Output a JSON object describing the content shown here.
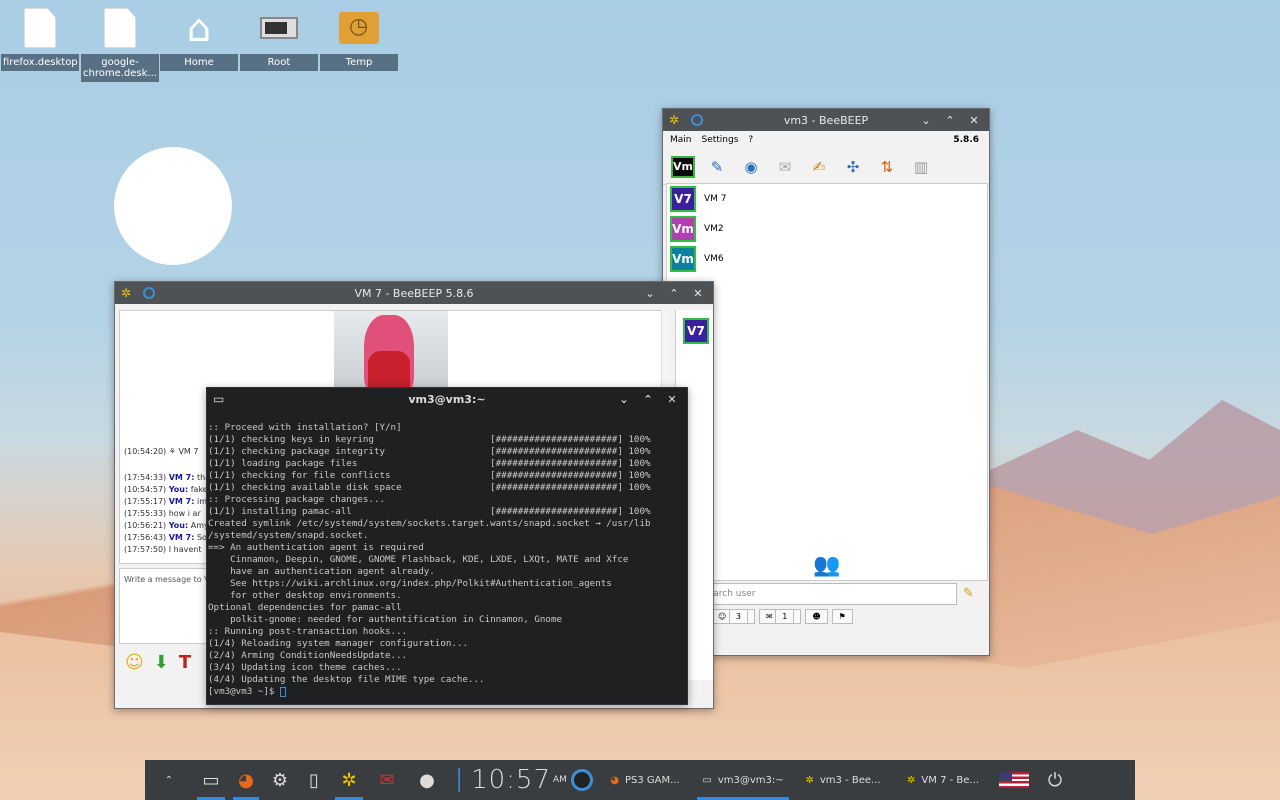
{
  "desktop": {
    "icons": [
      {
        "label": "firefox.desktop"
      },
      {
        "label": "google-chrome.desk..."
      },
      {
        "label": "Home"
      },
      {
        "label": "Root"
      },
      {
        "label": "Temp"
      }
    ]
  },
  "beebeep_main": {
    "title": "vm3 - BeeBEEP",
    "menu": {
      "main": "Main",
      "settings": "Settings",
      "help": "?"
    },
    "version": "5.8.6",
    "my_badge": "Vm",
    "users": [
      {
        "initials": "V7",
        "name": "VM 7",
        "color": "#3a1fa0"
      },
      {
        "initials": "Vm",
        "name": "VM2",
        "color": "#b040b0"
      },
      {
        "initials": "Vm",
        "name": "VM6",
        "color": "#1080a0"
      }
    ],
    "search_placeholder": "Search user",
    "tabs": {
      "users": "3",
      "chats": "1"
    }
  },
  "beebeep_chat": {
    "title": "VM 7 - BeeBEEP 5.8.6",
    "messages": [
      {
        "time": "(10:54:20)",
        "sender": "",
        "text": "VM 7"
      },
      {
        "time": "(17:54:33)",
        "sender": "VM 7:",
        "text": "tha"
      },
      {
        "time": "(10:54:57)",
        "sender": "You:",
        "text": "fake"
      },
      {
        "time": "(17:55:17)",
        "sender": "VM 7:",
        "text": "im g"
      },
      {
        "time": "(17:55:33)",
        "sender": "",
        "text": "how i ar"
      },
      {
        "time": "(10:56:21)",
        "sender": "You:",
        "text": "Amy"
      },
      {
        "time": "(17:56:43)",
        "sender": "VM 7:",
        "text": "Sor"
      },
      {
        "time": "(17:57:50)",
        "sender": "",
        "text": "I havent"
      }
    ],
    "input_placeholder": "Write a message to V",
    "side_badge": "V7"
  },
  "terminal": {
    "title": "vm3@vm3:~",
    "lines": [
      ":: Proceed with installation? [Y/n]",
      "(1/1) checking keys in keyring                     [######################] 100%",
      "(1/1) checking package integrity                   [######################] 100%",
      "(1/1) loading package files                        [######################] 100%",
      "(1/1) checking for file conflicts                  [######################] 100%",
      "(1/1) checking available disk space                [######################] 100%",
      ":: Processing package changes...",
      "(1/1) installing pamac-all                         [######################] 100%",
      "Created symlink /etc/systemd/system/sockets.target.wants/snapd.socket → /usr/lib",
      "/systemd/system/snapd.socket.",
      "==> An authentication agent is required",
      "    Cinnamon, Deepin, GNOME, GNOME Flashback, KDE, LXDE, LXQt, MATE and Xfce",
      "    have an authentication agent already.",
      "    See https://wiki.archlinux.org/index.php/Polkit#Authentication_agents",
      "    for other desktop environments.",
      "Optional dependencies for pamac-all",
      "    polkit-gnome: needed for authentification in Cinnamon, Gnome",
      ":: Running post-transaction hooks...",
      "(1/4) Reloading system manager configuration...",
      "(2/4) Arming ConditionNeedsUpdate...",
      "(3/4) Updating icon theme caches...",
      "(4/4) Updating the desktop file MIME type cache..."
    ],
    "prompt": "[vm3@vm3 ~]$ "
  },
  "taskbar": {
    "clock": "10:57",
    "ampm": "AM",
    "tasks": [
      {
        "label": "PS3 GAM..."
      },
      {
        "label": "vm3@vm3:~"
      },
      {
        "label": "vm3 - Bee..."
      },
      {
        "label": "VM 7 - Be..."
      }
    ]
  }
}
